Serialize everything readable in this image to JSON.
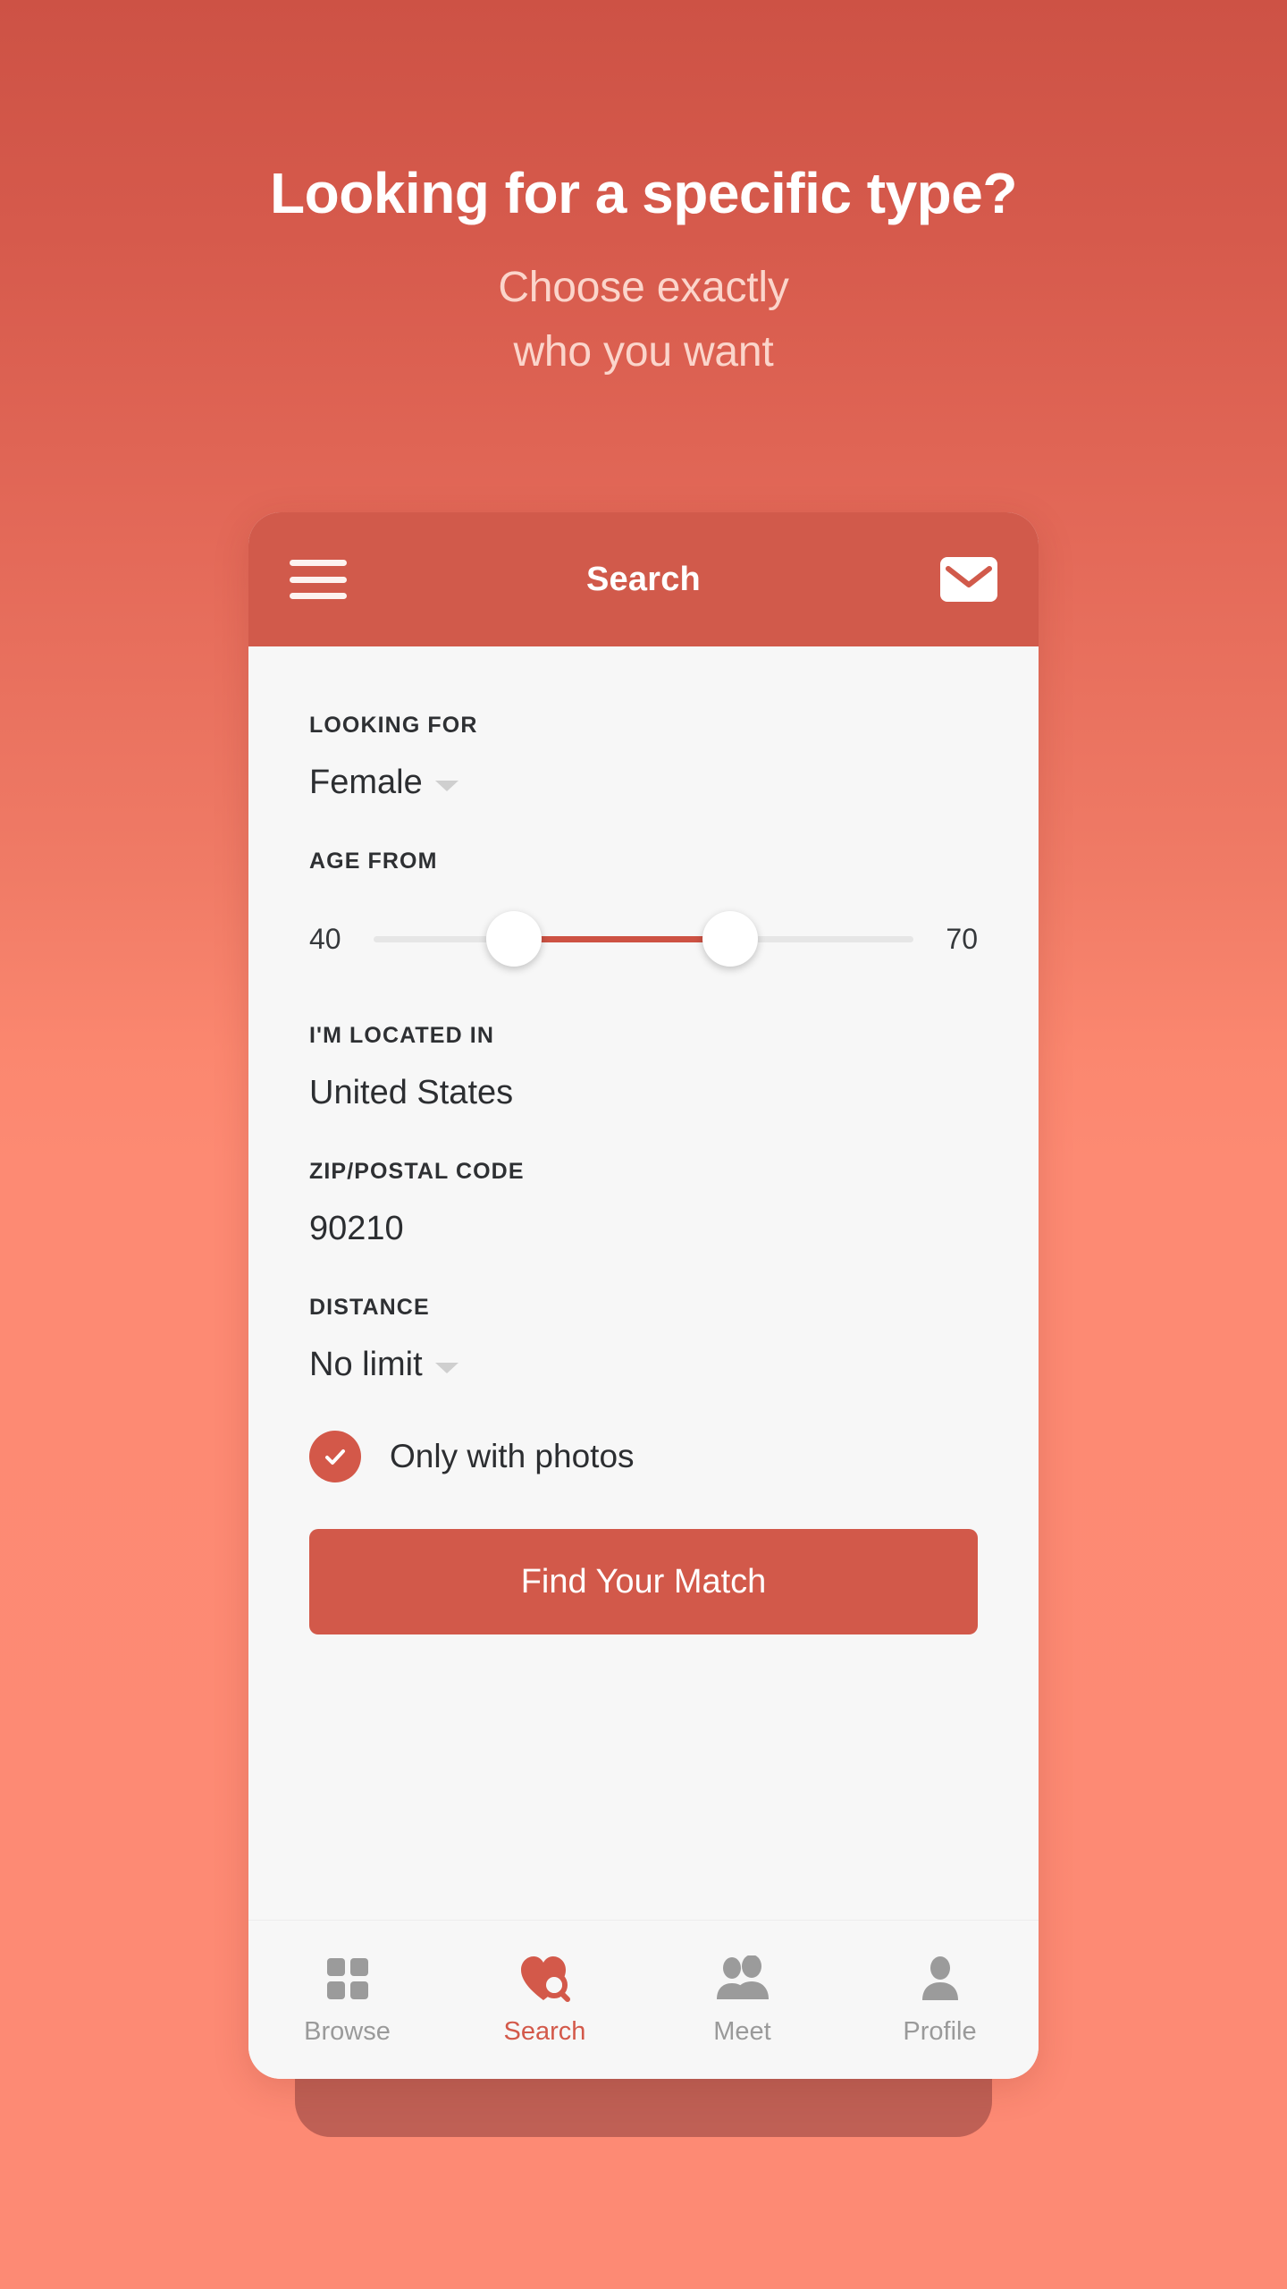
{
  "hero": {
    "title": "Looking for a specific type?",
    "subtitle_line1": "Choose exactly",
    "subtitle_line2": "who you want"
  },
  "theme": {
    "brand": "#d2594a",
    "bg_top": "#cd5245",
    "bg_bottom": "#fd8a74",
    "subtitle_color": "#fbd5cb",
    "card_bg": "#f7f7f7"
  },
  "phone": {
    "header": {
      "menu_icon": "hamburger-icon",
      "title": "Search",
      "mail_icon": "envelope-icon"
    },
    "fields": [
      {
        "label": "LOOKING FOR",
        "value": "Female",
        "type": "dropdown"
      },
      {
        "label": "AGE FROM",
        "type": "range-slider",
        "min_label": "40",
        "max_label": "70",
        "range_min": 40,
        "range_max": 70,
        "selected_low": 48,
        "selected_high": 60
      },
      {
        "label": "I'M LOCATED IN",
        "value": "United States",
        "type": "text"
      },
      {
        "label": "ZIP/POSTAL CODE",
        "value": "90210",
        "type": "text"
      },
      {
        "label": "DISTANCE",
        "value": "No limit",
        "type": "dropdown"
      }
    ],
    "checkbox": {
      "label": "Only with photos",
      "checked": true
    },
    "cta_label": "Find Your Match",
    "tabs": [
      {
        "label": "Browse",
        "icon": "grid-icon",
        "active": false
      },
      {
        "label": "Search",
        "icon": "heart-search-icon",
        "active": true
      },
      {
        "label": "Meet",
        "icon": "people-icon",
        "active": false
      },
      {
        "label": "Profile",
        "icon": "person-icon",
        "active": false
      }
    ]
  }
}
